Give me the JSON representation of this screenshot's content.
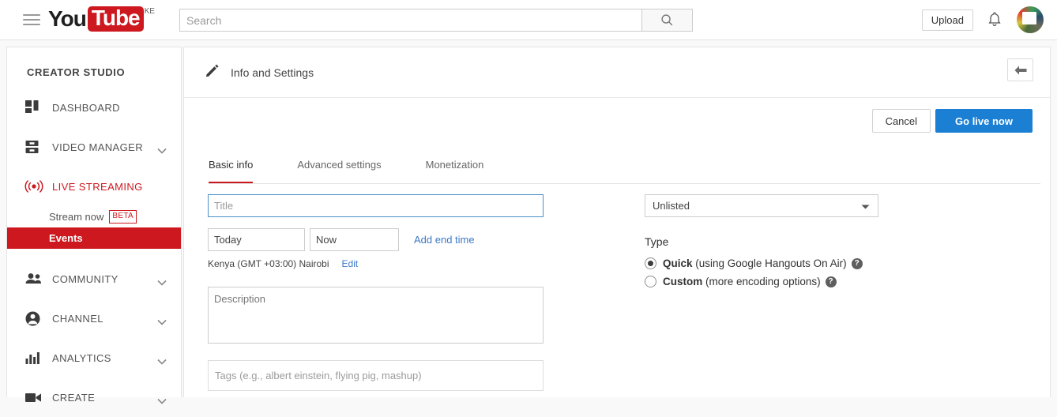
{
  "topbar": {
    "menu_icon": "hamburger-icon",
    "logo": {
      "part1": "You",
      "part2": "Tube",
      "country": "KE"
    },
    "search": {
      "placeholder": "Search",
      "value": "",
      "icon": "search-icon"
    },
    "upload_label": "Upload",
    "bell_icon": "notifications-bell-icon",
    "avatar_icon": "account-avatar"
  },
  "sidebar": {
    "title": "CREATOR STUDIO",
    "items": [
      {
        "label": "DASHBOARD",
        "icon": "dashboard-grid-icon",
        "expandable": false
      },
      {
        "label": "VIDEO MANAGER",
        "icon": "video-manager-icon",
        "expandable": true
      },
      {
        "label": "LIVE STREAMING",
        "icon": "live-broadcast-icon",
        "expandable": false,
        "active": true
      },
      {
        "label": "COMMUNITY",
        "icon": "community-people-icon",
        "expandable": true
      },
      {
        "label": "CHANNEL",
        "icon": "channel-person-icon",
        "expandable": true
      },
      {
        "label": "ANALYTICS",
        "icon": "analytics-bars-icon",
        "expandable": true
      },
      {
        "label": "CREATE",
        "icon": "create-camera-icon",
        "expandable": true
      }
    ],
    "sub_items": [
      {
        "label": "Stream now",
        "badge": "BETA",
        "selected": false
      },
      {
        "label": "Events",
        "badge": "",
        "selected": true
      }
    ]
  },
  "panel": {
    "header_title": "Info and Settings",
    "header_icon": "pencil-edit-icon",
    "back_icon": "back-arrow-icon",
    "cancel_label": "Cancel",
    "go_live_label": "Go live now",
    "tabs": [
      {
        "label": "Basic info",
        "active": true
      },
      {
        "label": "Advanced settings",
        "active": false
      },
      {
        "label": "Monetization",
        "active": false
      }
    ]
  },
  "form": {
    "title_placeholder": "Title",
    "title_value": "",
    "date_value": "Today",
    "time_value": "Now",
    "add_end_time_label": "Add end time",
    "timezone_text": "Kenya (GMT +03:00) Nairobi",
    "timezone_edit_label": "Edit",
    "description_placeholder": "Description",
    "description_value": "",
    "tags_placeholder": "Tags (e.g., albert einstein, flying pig, mashup)",
    "tags_value": ""
  },
  "settings": {
    "privacy_selected": "Unlisted",
    "privacy_caret_icon": "chevron-down-icon",
    "type_label": "Type",
    "type_options": [
      {
        "name": "Quick",
        "detail": "(using Google Hangouts On Air)",
        "selected": true,
        "help_icon": "help-question-icon"
      },
      {
        "name": "Custom",
        "detail": "(more encoding options)",
        "selected": false,
        "help_icon": "help-question-icon"
      }
    ]
  },
  "colors": {
    "brand_red": "#cc181e",
    "action_blue": "#1b7fd4",
    "link_blue": "#3b78c8",
    "page_bg": "#f9f9f9"
  }
}
